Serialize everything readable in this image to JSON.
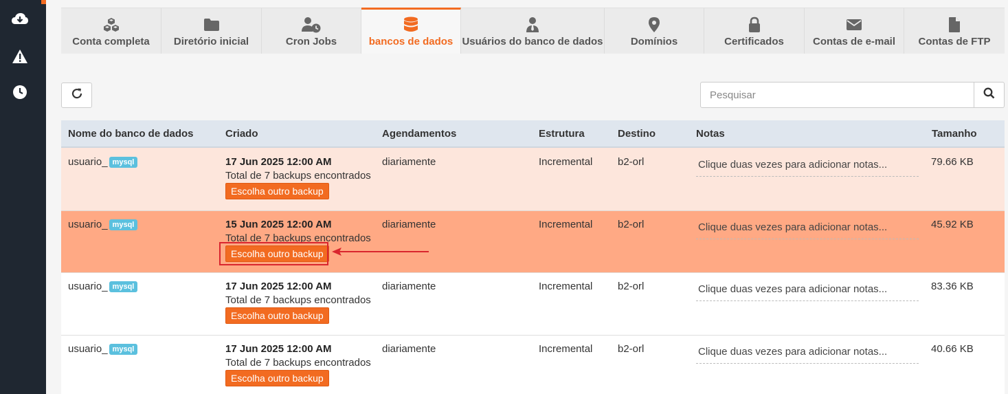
{
  "sidebar": {
    "icons": [
      "cloud-download-icon",
      "warning-icon",
      "clock-icon"
    ]
  },
  "tabs": [
    {
      "label": "Conta completa",
      "icon": "cubes-icon",
      "active": false
    },
    {
      "label": "Diretório inicial",
      "icon": "folder-icon",
      "active": false
    },
    {
      "label": "Cron Jobs",
      "icon": "user-clock-icon",
      "active": false
    },
    {
      "label": "bancos de dados",
      "icon": "database-icon",
      "active": true
    },
    {
      "label": "Usuários do banco de dados",
      "icon": "user-tie-icon",
      "active": false
    },
    {
      "label": "Domínios",
      "icon": "map-marker-icon",
      "active": false
    },
    {
      "label": "Certificados",
      "icon": "lock-icon",
      "active": false
    },
    {
      "label": "Contas de e-mail",
      "icon": "envelope-icon",
      "active": false
    },
    {
      "label": "Contas de FTP",
      "icon": "file-icon",
      "active": false
    }
  ],
  "search": {
    "placeholder": "Pesquisar"
  },
  "table": {
    "headers": [
      "Nome do banco de dados",
      "Criado",
      "Agendamentos",
      "Estrutura",
      "Destino",
      "Notas",
      "Tamanho"
    ],
    "rows": [
      {
        "name": "usuario_",
        "badge": "mysql",
        "date": "17 Jun 2025 12:00 AM",
        "total": "Total de 7 backups encontrados",
        "button": "Escolha outro backup",
        "schedule": "diariamente",
        "structure": "Incremental",
        "destination": "b2-orl",
        "notes": "Clique duas vezes para adicionar notas...",
        "size": "79.66 KB"
      },
      {
        "name": "usuario_",
        "badge": "mysql",
        "date": "15 Jun 2025 12:00 AM",
        "total": "Total de 7 backups encontrados",
        "button": "Escolha outro backup",
        "schedule": "diariamente",
        "structure": "Incremental",
        "destination": "b2-orl",
        "notes": "Clique duas vezes para adicionar notas...",
        "size": "45.92 KB"
      },
      {
        "name": "usuario_",
        "badge": "mysql",
        "date": "17 Jun 2025 12:00 AM",
        "total": "Total de 7 backups encontrados",
        "button": "Escolha outro backup",
        "schedule": "diariamente",
        "structure": "Incremental",
        "destination": "b2-orl",
        "notes": "Clique duas vezes para adicionar notas...",
        "size": "83.36 KB"
      },
      {
        "name": "usuario_",
        "badge": "mysql",
        "date": "17 Jun 2025 12:00 AM",
        "total": "Total de 7 backups encontrados",
        "button": "Escolha outro backup",
        "schedule": "diariamente",
        "structure": "Incremental",
        "destination": "b2-orl",
        "notes": "Clique duas vezes para adicionar notas...",
        "size": "40.66 KB"
      }
    ]
  },
  "colors": {
    "accent": "#f26b21",
    "selected_row": "#ffa984",
    "first_row": "#fde6dc",
    "annotation": "#d9262e"
  }
}
